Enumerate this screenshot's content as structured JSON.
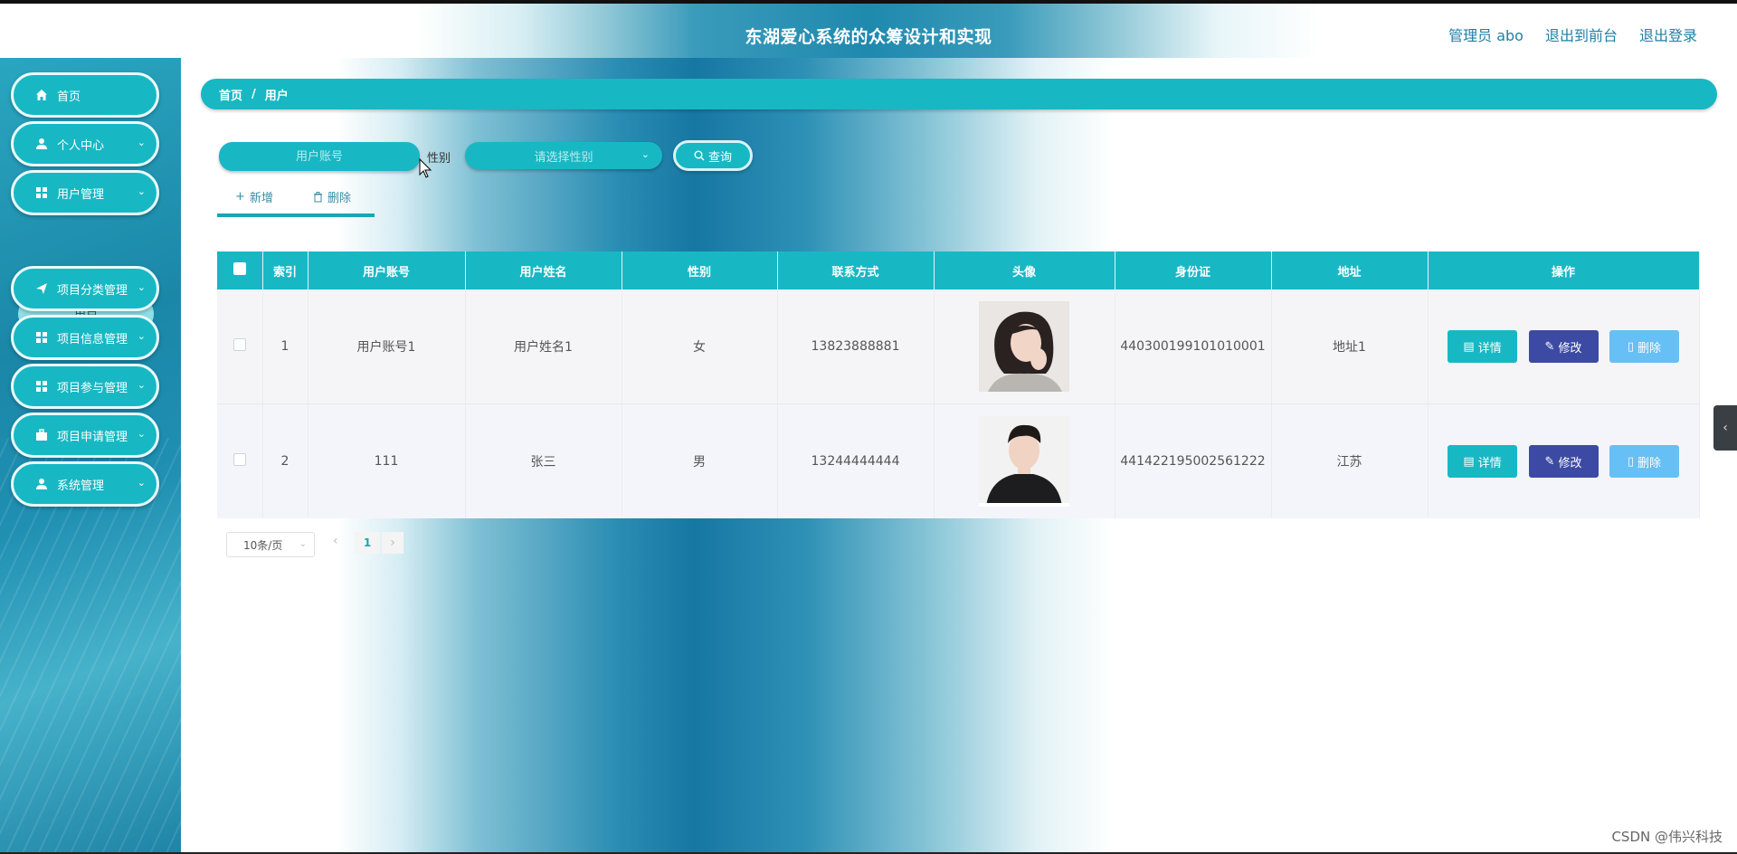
{
  "header": {
    "title": "东湖爱心系统的众筹设计和实现",
    "links": [
      "管理员 abo",
      "退出到前台",
      "退出登录"
    ]
  },
  "sidebar": {
    "items": [
      {
        "label": "首页",
        "icon": "home-icon"
      },
      {
        "label": "个人中心",
        "icon": "user-icon"
      },
      {
        "label": "用户管理",
        "icon": "grid-icon"
      },
      {
        "label": "项目分类管理",
        "icon": "send-icon"
      },
      {
        "label": "项目信息管理",
        "icon": "grid-icon"
      },
      {
        "label": "项目参与管理",
        "icon": "grid-icon"
      },
      {
        "label": "项目申请管理",
        "icon": "briefcase-icon"
      },
      {
        "label": "系统管理",
        "icon": "user-icon"
      }
    ],
    "submenu_label": "用户"
  },
  "breadcrumb": {
    "home": "首页",
    "sep": "/",
    "current": "用户"
  },
  "search": {
    "account_placeholder": "用户账号",
    "sex_label": "性别",
    "sex_placeholder": "请选择性别",
    "query_label": "查询"
  },
  "actions": {
    "add": "新增",
    "delete": "删除"
  },
  "table": {
    "headers": [
      "索引",
      "用户账号",
      "用户姓名",
      "性别",
      "联系方式",
      "头像",
      "身份证",
      "地址",
      "操作"
    ],
    "rows": [
      {
        "index": "1",
        "account": "用户账号1",
        "name": "用户姓名1",
        "sex": "女",
        "phone": "13823888881",
        "idcard": "440300199101010001",
        "address": "地址1"
      },
      {
        "index": "2",
        "account": "111",
        "name": "张三",
        "sex": "男",
        "phone": "13244444444",
        "idcard": "441422195002561222",
        "address": "江苏"
      }
    ],
    "row_actions": {
      "detail": "详情",
      "edit": "修改",
      "delete": "删除"
    }
  },
  "pagination": {
    "page_size": "10条/页",
    "current_page": "1"
  },
  "watermark": "CSDN @伟兴科技",
  "colors": {
    "primary": "#17b8c4",
    "edit": "#3c4aa3",
    "delete": "#66bff5"
  }
}
